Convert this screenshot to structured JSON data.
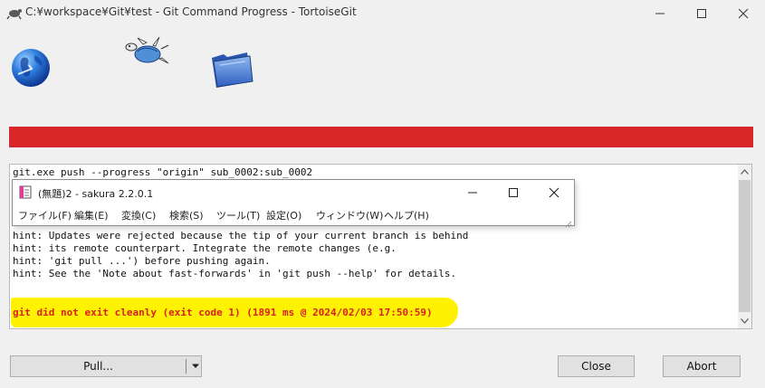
{
  "window": {
    "title": "C:¥workspace¥Git¥test - Git Command Progress - TortoiseGit",
    "app_icon": "tortoisegit-turtle-icon",
    "controls": [
      "minimize-icon",
      "maximize-icon",
      "close-icon"
    ]
  },
  "animation": {
    "icons": [
      "globe-icon",
      "flying-turtle-icon",
      "folder-icon"
    ]
  },
  "progress": {
    "fraction": 1.0,
    "color": "#d92628",
    "status": "error"
  },
  "log": {
    "command": "git.exe push --progress \"origin\" sub_0002:sub_0002",
    "lines": [
      "hint: Updates were rejected because the tip of your current branch is behind",
      "hint: its remote counterpart. Integrate the remote changes (e.g.",
      "hint: 'git pull ...') before pushing again.",
      "hint: See the 'Note about fast-forwards' in 'git push --help' for details."
    ],
    "error": "git did not exit cleanly (exit code 1) (1891 ms @ 2024/02/03 17:50:59)",
    "error_color": "#d81e1e",
    "highlight_color": "#fff200"
  },
  "popup": {
    "title": "(無題)2 - sakura 2.2.0.1",
    "menu": [
      "ファイル(F)",
      "編集(E)",
      "変換(C)",
      "検索(S)",
      "ツール(T)",
      "設定(O)",
      "ウィンドウ(W)",
      "ヘルプ(H)"
    ]
  },
  "buttons": {
    "pull": "Pull...",
    "close": "Close",
    "abort": "Abort"
  }
}
